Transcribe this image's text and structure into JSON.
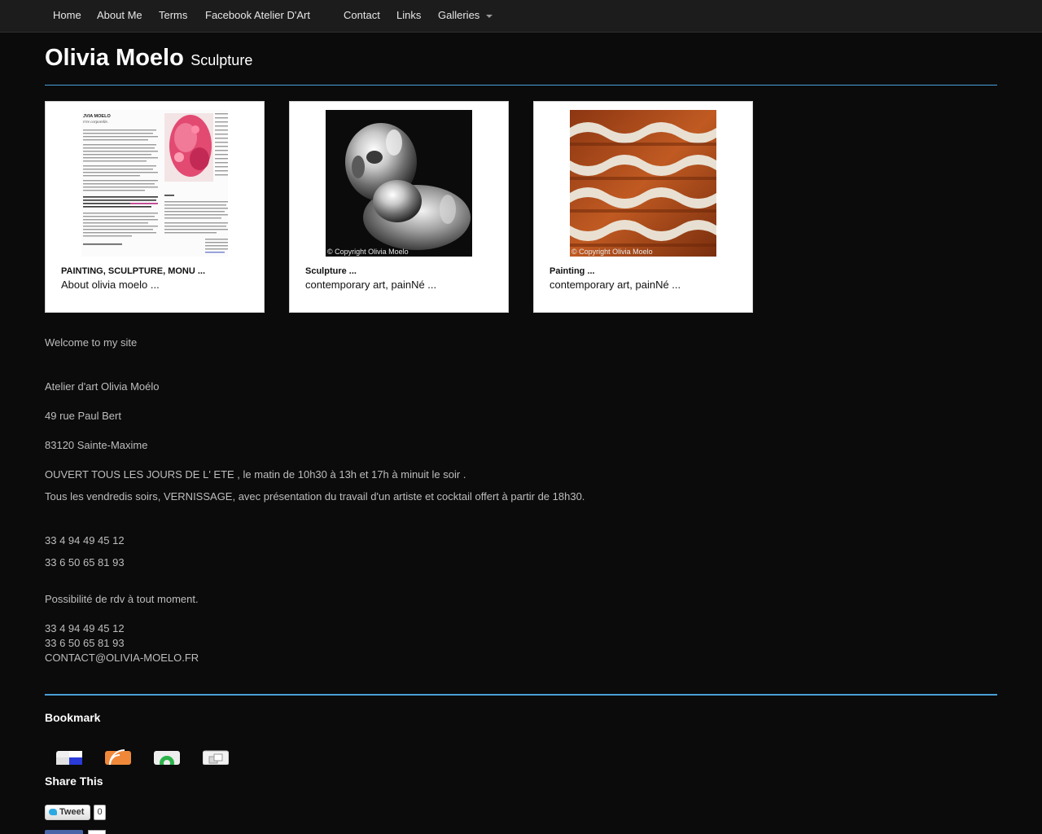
{
  "nav": {
    "items": [
      "Home",
      "About Me",
      "Terms",
      "Facebook Atelier D'Art",
      "Contact",
      "Links",
      "Galleries"
    ]
  },
  "header": {
    "title": "Olivia Moelo",
    "subtitle": "Sculpture"
  },
  "cards": [
    {
      "title": "PAINTING, SCULPTURE, MONU ...",
      "desc": "About olivia moelo ...",
      "copyright": ""
    },
    {
      "title": "Sculpture ...",
      "desc": "contemporary art, painNé ...",
      "copyright": "© Copyright Olivia  Moelo"
    },
    {
      "title": "Painting ...",
      "desc": "contemporary art, painNé ...",
      "copyright": "© Copyright Olivia  Moelo"
    }
  ],
  "content": {
    "welcome": "Welcome to my site",
    "atelier": "Atelier d'art Olivia Moélo",
    "street": "49 rue Paul Bert",
    "city": "83120  Sainte-Maxime",
    "hours": "OUVERT TOUS LES JOURS DE L' ETE , le matin de 10h30 à 13h  et 17h à minuit le soir .",
    "vernissage": "Tous les vendredis soirs, VERNISSAGE, avec présentation du travail d'un artiste et cocktail offert à partir de 18h30.",
    "phone1": "33 4 94 49 45 12",
    "phone2": "33 6 50 65 81 93",
    "rdv": "Possibilité de rdv à tout moment.",
    "phone1b": "33 4 94 49 45 12",
    "phone2b": "33 6 50 65 81 93",
    "email": "CONTACT@OLIVIA-MOELO.FR"
  },
  "bookmark": {
    "heading": "Bookmark",
    "icons": [
      "delicious-icon",
      "rss-icon",
      "stumbleupon-icon",
      "bookmark-icon"
    ]
  },
  "share": {
    "heading": "Share This",
    "tweet_label": "Tweet",
    "tweet_count": "0"
  },
  "colors": {
    "background": "#0b0b0b",
    "accent_rule": "#4a9fd6",
    "nav_bar": "#1c1c1c"
  }
}
